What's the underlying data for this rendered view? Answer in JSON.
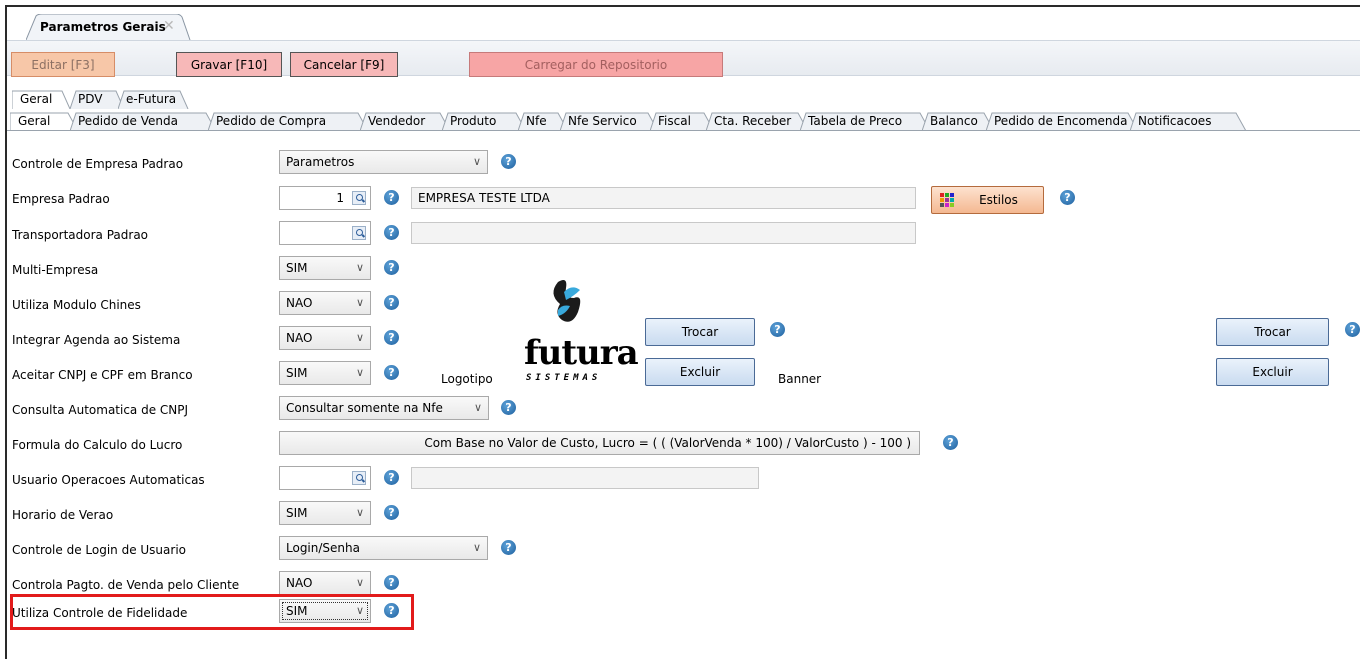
{
  "document_tab": {
    "title": "Parametros Gerais",
    "close": "✕"
  },
  "toolbar": {
    "edit": "Editar [F3]",
    "save": "Gravar [F10]",
    "cancel": "Cancelar [F9]",
    "load": "Carregar do Repositorio"
  },
  "tabs_level1": [
    "Geral",
    "PDV",
    "e-Futura"
  ],
  "tabs_level2": [
    "Geral",
    "Pedido de Venda",
    "Pedido de Compra",
    "Vendedor",
    "Produto",
    "Nfe",
    "Nfe Servico",
    "Fiscal",
    "Cta. Receber",
    "Tabela de Preco",
    "Balanco",
    "Pedido de Encomenda",
    "Notificacoes"
  ],
  "fields": {
    "controle_empresa": {
      "label": "Controle de Empresa Padrao",
      "value": "Parametros"
    },
    "empresa_padrao": {
      "label": "Empresa Padrao",
      "value": "1",
      "description": "EMPRESA TESTE LTDA"
    },
    "transportadora": {
      "label": "Transportadora Padrao",
      "value": "",
      "description": ""
    },
    "multi_empresa": {
      "label": "Multi-Empresa",
      "value": "SIM"
    },
    "modulo_chines": {
      "label": "Utiliza Modulo Chines",
      "value": "NAO"
    },
    "agenda": {
      "label": "Integrar Agenda ao Sistema",
      "value": "NAO"
    },
    "cnpj_branco": {
      "label": "Aceitar CNPJ e CPF em Branco",
      "value": "SIM"
    },
    "consulta_cnpj": {
      "label": "Consulta Automatica de CNPJ",
      "value": "Consultar somente na Nfe"
    },
    "formula_lucro": {
      "label": "Formula do Calculo do Lucro",
      "value": "Com Base no Valor de Custo, Lucro = ( ( (ValorVenda * 100) / ValorCusto ) - 100 )"
    },
    "usuario_auto": {
      "label": "Usuario Operacoes Automaticas",
      "value": "",
      "description": ""
    },
    "horario_verao": {
      "label": "Horario de Verao",
      "value": "SIM"
    },
    "login_usuario": {
      "label": "Controle de Login de Usuario",
      "value": "Login/Senha"
    },
    "pagto_cliente": {
      "label": "Controla Pagto. de Venda pelo Cliente",
      "value": "NAO"
    },
    "fidelidade": {
      "label": "Utiliza Controle de Fidelidade",
      "value": "SIM"
    }
  },
  "estilos_button": "Estilos",
  "logo": {
    "label": "Logotipo",
    "brand": "futura",
    "tagline": "SISTEMAS",
    "trocar": "Trocar",
    "excluir": "Excluir"
  },
  "banner": {
    "label": "Banner",
    "trocar": "Trocar",
    "excluir": "Excluir"
  },
  "help_glyph": "?",
  "dropdown_glyph": "∨",
  "colors": {
    "highlight": "#e21b1b",
    "help": "#1d5f9e",
    "toolbar_button": "#f7b8b8"
  }
}
